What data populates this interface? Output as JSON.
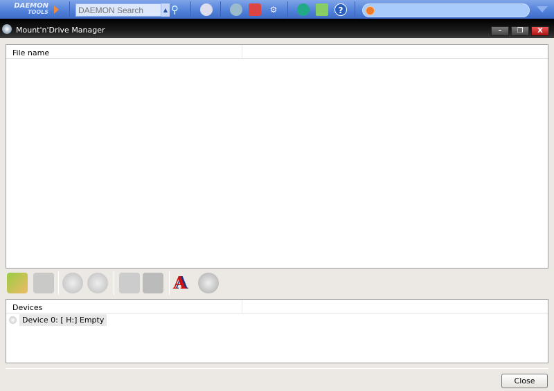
{
  "topbar": {
    "logo_top": "DAEMON",
    "logo_bottom": "TOOLS",
    "search_placeholder": "DAEMON Search",
    "address_value": ""
  },
  "window": {
    "title": "Mount'n'Drive Manager",
    "minimize": "–",
    "restore": "❐",
    "close": "X"
  },
  "images_panel": {
    "columns": [
      "File name",
      ""
    ]
  },
  "devices_panel": {
    "columns": [
      "Devices",
      ""
    ],
    "items": [
      {
        "label": "Device 0: [ H:] Empty"
      }
    ]
  },
  "footer": {
    "close_label": "Close"
  }
}
